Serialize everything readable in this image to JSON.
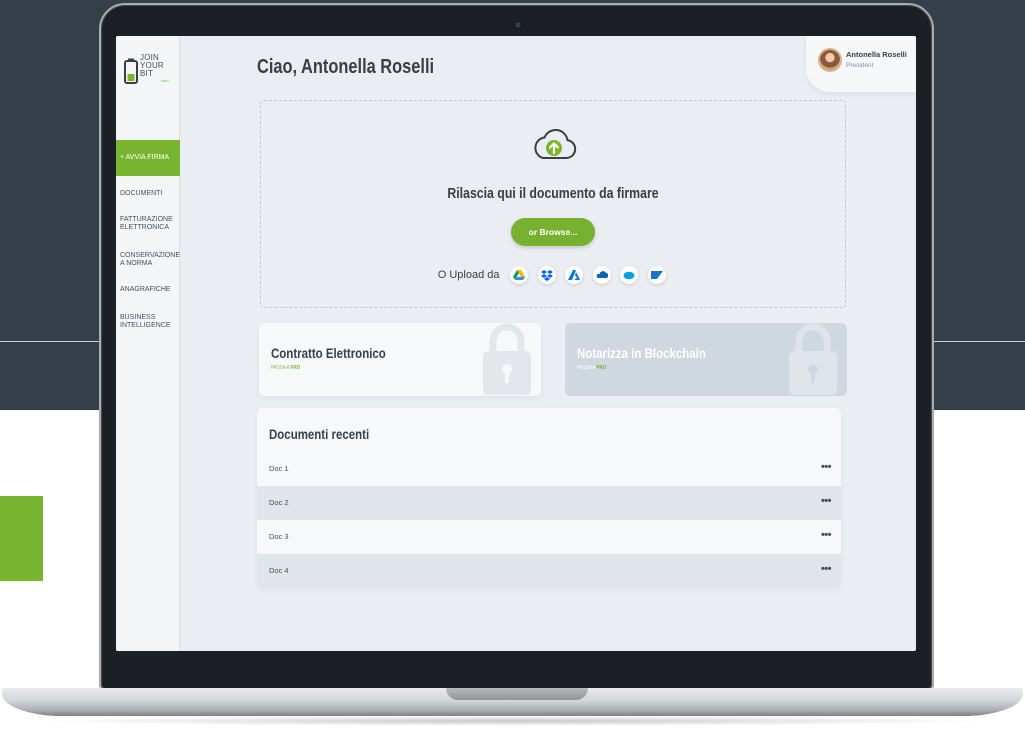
{
  "brand": {
    "logo_lines": [
      "JOIN",
      "YOUR",
      "BIT"
    ],
    "logo_suffix": ".com",
    "accent_color": "#7ab531"
  },
  "sidebar": {
    "items": [
      {
        "label": "+ AVVIA FIRMA",
        "active": true
      },
      {
        "label": "DOCUMENTI"
      },
      {
        "label": "FATTURAZIONE ELETTRONICA"
      },
      {
        "label": "CONSERVAZIONE A NORMA"
      },
      {
        "label": "ANAGRAFICHE"
      },
      {
        "label": "BUSINESS INTELLIGENCE"
      }
    ]
  },
  "header": {
    "greeting": "Ciao, Antonella Roselli"
  },
  "user": {
    "name": "Antonella Roselli",
    "role": "President"
  },
  "upload": {
    "icon": "cloud-upload-icon",
    "title": "Rilascia qui il documento da firmare",
    "browse_label": "or Browse...",
    "from_label": "O Upload da",
    "services": [
      "google-drive-icon",
      "dropbox-icon",
      "azure-icon",
      "onedrive-icon",
      "salesforce-icon",
      "sap-icon"
    ]
  },
  "cards": [
    {
      "title": "Contratto Elettronico",
      "sub_prefix": "PASSA A ",
      "sub_strong": "PRO"
    },
    {
      "title": "Notarizza in Blockchain",
      "sub_prefix": "PASSA A ",
      "sub_strong": "PRO"
    }
  ],
  "recent": {
    "title": "Documenti recenti",
    "docs": [
      {
        "name": "Doc 1",
        "menu": "•••"
      },
      {
        "name": "Doc 2",
        "menu": "•••"
      },
      {
        "name": "Doc 3",
        "menu": "•••"
      },
      {
        "name": "Doc 4",
        "menu": "•••"
      }
    ]
  }
}
